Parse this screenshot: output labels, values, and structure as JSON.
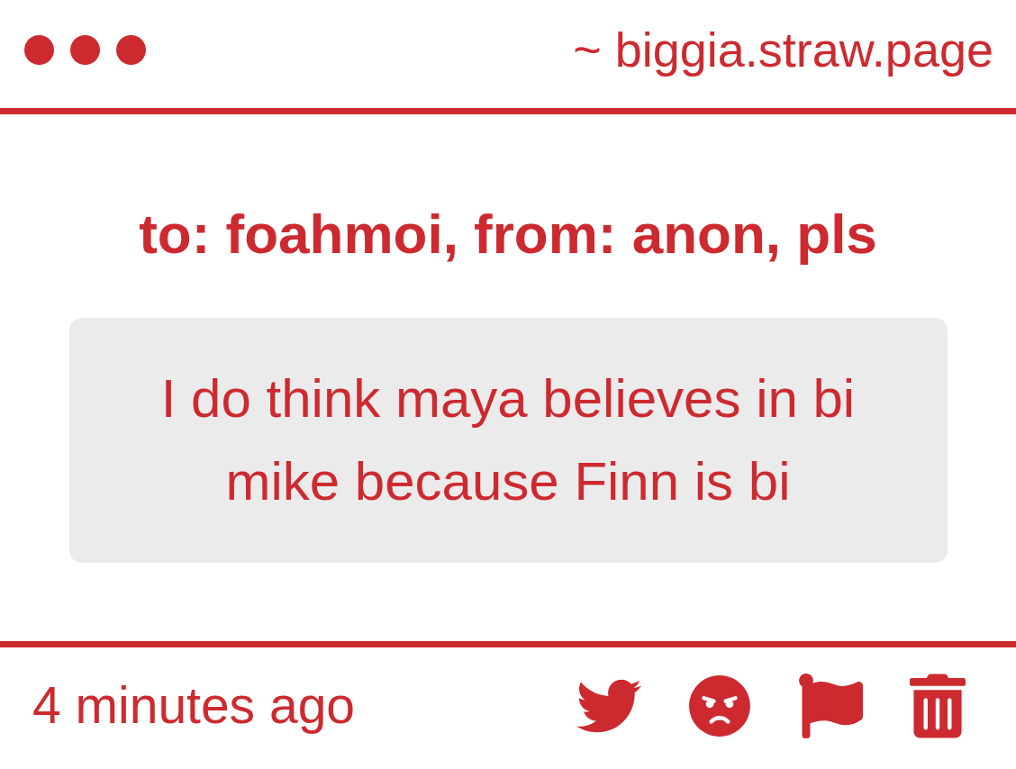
{
  "window": {
    "address": "~ biggia.straw.page"
  },
  "post": {
    "title": "to: foahmoi, from: anon, pls",
    "message": "I do think maya believes in bi mike because Finn is bi"
  },
  "footer": {
    "time": "4 minutes ago"
  }
}
